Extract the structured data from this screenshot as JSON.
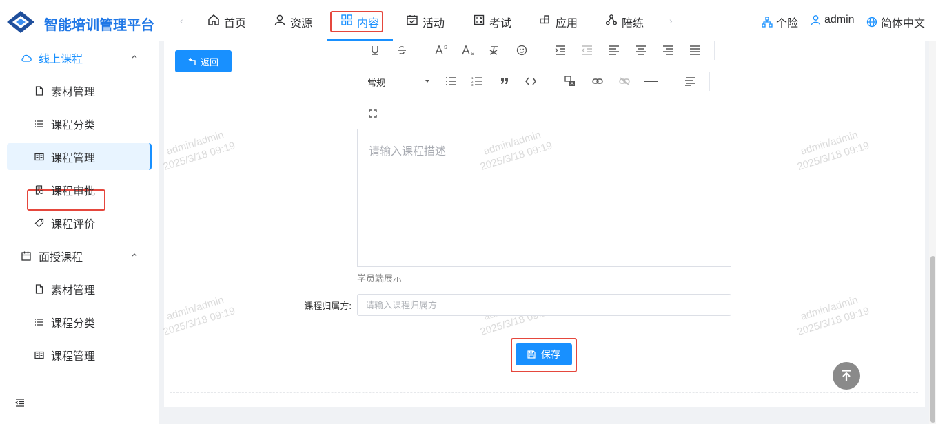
{
  "app": {
    "title": "智能培训管理平台",
    "brand_color": "#1f77e6",
    "accent": "#1890ff"
  },
  "topnav": {
    "items": [
      {
        "label": "首页",
        "icon": "home-icon"
      },
      {
        "label": "资源",
        "icon": "user-icon"
      },
      {
        "label": "内容",
        "icon": "grid-icon",
        "active": true
      },
      {
        "label": "活动",
        "icon": "calendar-check-icon"
      },
      {
        "label": "考试",
        "icon": "exam-icon"
      },
      {
        "label": "应用",
        "icon": "apps-icon"
      },
      {
        "label": "陪练",
        "icon": "share-nodes-icon"
      }
    ],
    "org": "个险",
    "user": "admin",
    "language": "简体中文"
  },
  "sidebar": {
    "groups": [
      {
        "label": "线上课程",
        "icon": "cloud-icon",
        "expanded": true,
        "items": [
          {
            "label": "素材管理",
            "icon": "file-icon"
          },
          {
            "label": "课程分类",
            "icon": "list-icon"
          },
          {
            "label": "课程管理",
            "icon": "book-open-icon",
            "active": true
          },
          {
            "label": "课程审批",
            "icon": "approve-icon"
          },
          {
            "label": "课程评价",
            "icon": "tag-icon"
          }
        ]
      },
      {
        "label": "面授课程",
        "icon": "calendar-icon",
        "expanded": true,
        "items": [
          {
            "label": "素材管理",
            "icon": "file-icon"
          },
          {
            "label": "课程分类",
            "icon": "list-icon"
          },
          {
            "label": "课程管理",
            "icon": "book-open-icon"
          }
        ]
      }
    ]
  },
  "main": {
    "back_label": "返回",
    "editor": {
      "heading_select": "常规",
      "placeholder": "请输入课程描述",
      "hint": "学员端展示"
    },
    "owner_field": {
      "label": "课程归属方:",
      "placeholder": "请输入课程归属方",
      "value": ""
    },
    "save_label": "保存"
  },
  "watermark": {
    "line1": "admin/admin",
    "line2": "2025/3/18 09:19"
  }
}
